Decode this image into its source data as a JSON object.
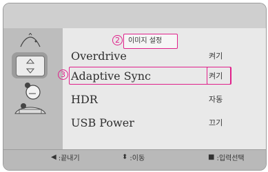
{
  "menu_title": "이미지 설정",
  "callouts": {
    "title_badge": "2",
    "row_badge": "3"
  },
  "items": [
    {
      "label": "Overdrive",
      "value": "켜기"
    },
    {
      "label": "Adaptive Sync",
      "value": "켜기"
    },
    {
      "label": "HDR",
      "value": "자동"
    },
    {
      "label": "USB Power",
      "value": "끄기"
    }
  ],
  "footer": {
    "exit_label": ":끝내기",
    "move_label": ":이동",
    "enter_label": ":입력선택"
  },
  "colors": {
    "highlight": "#e01f8a"
  },
  "icons": [
    "picture-icon",
    "selected-adjust-icon",
    "bulb-icon",
    "keyboard-icon"
  ]
}
